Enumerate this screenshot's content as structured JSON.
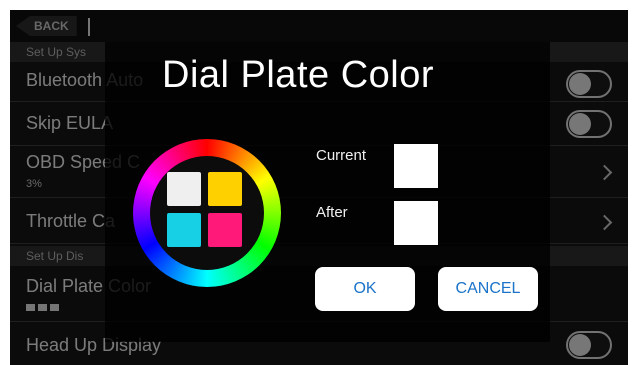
{
  "topbar": {
    "back_label": "BACK"
  },
  "sections": [
    "Set Up Sys",
    "Set Up Dis"
  ],
  "rows": [
    {
      "label": "Bluetooth Auto"
    },
    {
      "label": "Skip EULA"
    },
    {
      "label": "OBD Speed C",
      "sub": "3%"
    },
    {
      "label": "Throttle Ca"
    },
    {
      "label": "Dial Plate Color"
    },
    {
      "label": "Head Up Display"
    }
  ],
  "dialog": {
    "title": "Dial Plate Color",
    "current_label": "Current",
    "after_label": "After",
    "ok_label": "OK",
    "cancel_label": "CANCEL"
  },
  "colors": {
    "swatches": [
      "#efefef",
      "#ffd000",
      "#18d0e6",
      "#ff1a7a"
    ],
    "current": "#ffffff",
    "after": "#ffffff",
    "button_text": "#1a73c9"
  }
}
